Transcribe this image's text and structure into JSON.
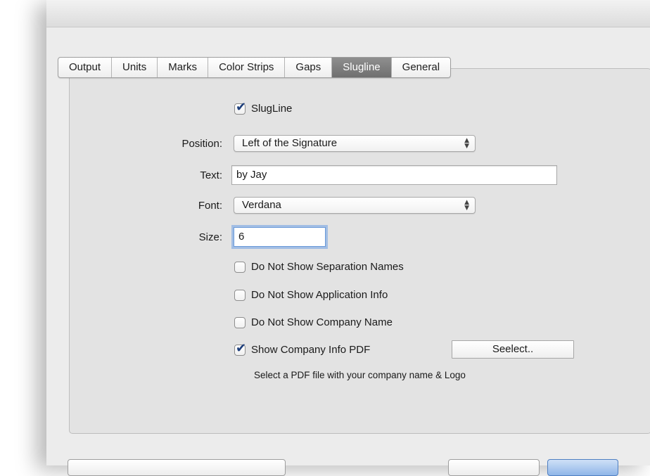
{
  "tabs": [
    {
      "label": "Output",
      "selected": false
    },
    {
      "label": "Units",
      "selected": false
    },
    {
      "label": "Marks",
      "selected": false
    },
    {
      "label": "Color Strips",
      "selected": false
    },
    {
      "label": "Gaps",
      "selected": false
    },
    {
      "label": "Slugline",
      "selected": true
    },
    {
      "label": "General",
      "selected": false
    }
  ],
  "slugline": {
    "label": "SlugLine",
    "checked": true
  },
  "position": {
    "label": "Position:",
    "value": "Left of the Signature"
  },
  "text": {
    "label": "Text:",
    "value": "by Jay"
  },
  "font": {
    "label": "Font:",
    "value": "Verdana"
  },
  "size": {
    "label": "Size:",
    "value": "6"
  },
  "options": [
    {
      "label": "Do Not Show Separation Names",
      "checked": false
    },
    {
      "label": "Do Not Show Application Info",
      "checked": false
    },
    {
      "label": "Do Not Show Company Name",
      "checked": false
    },
    {
      "label": "Show Company Info PDF",
      "checked": true
    }
  ],
  "select_button": {
    "label": "Seelect.."
  },
  "hint": "Select a PDF file with your company name & Logo",
  "icons": {
    "popup_arrows": "up-down-chevron-icon",
    "check": "checkmark-icon"
  }
}
